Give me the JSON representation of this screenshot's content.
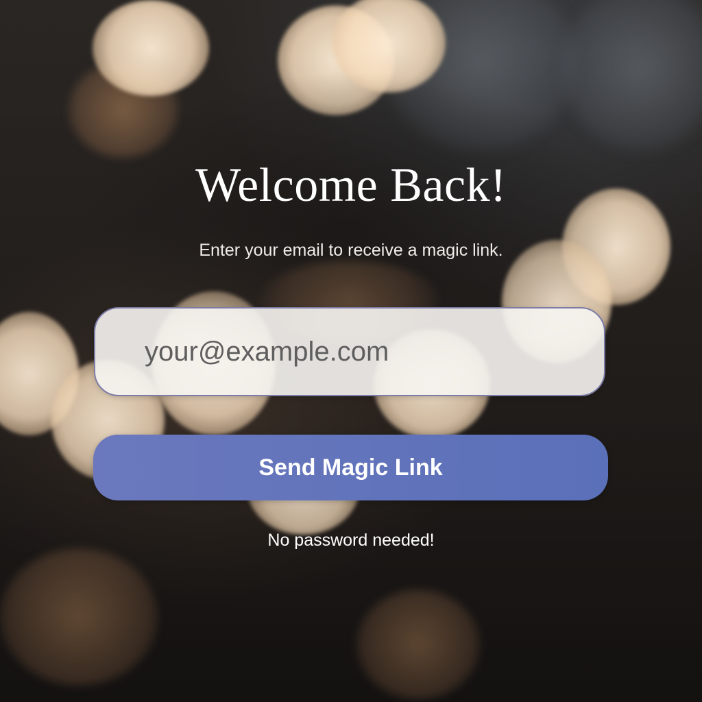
{
  "login": {
    "title": "Welcome Back!",
    "subtitle": "Enter your email to receive a magic link.",
    "email": {
      "value": "",
      "placeholder": "your@example.com"
    },
    "send_button_label": "Send Magic Link",
    "hint": "No password needed!"
  },
  "colors": {
    "button": "#6274bb",
    "field_border": "#7c7ca6",
    "field_background": "#f6f4f1",
    "text": "#ffffff"
  }
}
